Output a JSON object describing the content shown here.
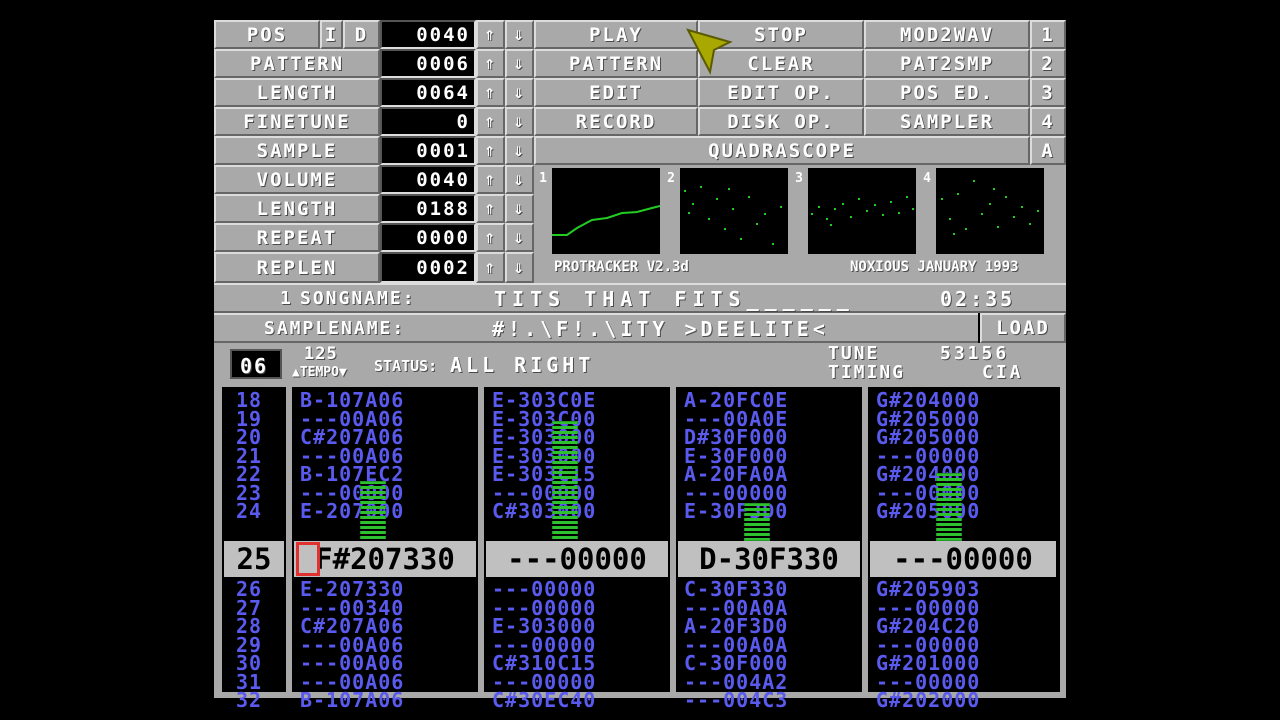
{
  "colors": {
    "panel": "#a9a9a9",
    "track_text": "#5a5aef",
    "scope_wave": "#22cc22",
    "vu_green": "#2fc02f",
    "vu_yellow": "#e0d040",
    "vu_red": "#d03030",
    "cursor": "#a8a800",
    "edit_cursor": "#e03030"
  },
  "left": {
    "pos_label": "POS",
    "i_label": "I",
    "d_label": "D",
    "pos_value": "0040",
    "pattern_label": "PATTERN",
    "pattern_value": "0006",
    "length_label": "LENGTH",
    "length_value": "0064",
    "finetune_label": "FINETUNE",
    "finetune_value": "0",
    "sample_label": "SAMPLE",
    "sample_value": "0001",
    "volume_label": "VOLUME",
    "volume_value": "0040",
    "slength_label": "LENGTH",
    "slength_value": "0188",
    "repeat_label": "REPEAT",
    "repeat_value": "0000",
    "replen_label": "REPLEN",
    "replen_value": "0002",
    "up_arrow": "⇑",
    "down_arrow": "⇓"
  },
  "buttons": {
    "play": "PLAY",
    "stop": "STOP",
    "mod2wav": "MOD2WAV",
    "one": "1",
    "pattern": "PATTERN",
    "clear": "CLEAR",
    "pat2smp": "PAT2SMP",
    "two": "2",
    "edit": "EDIT",
    "edit_op": "EDIT OP.",
    "pos_ed": "POS ED.",
    "three": "3",
    "record": "RECORD",
    "disk_op": "DISK OP.",
    "sampler": "SAMPLER",
    "four": "4",
    "quadrascope": "QUADRASCOPE",
    "a": "A",
    "load": "LOAD"
  },
  "scopes": {
    "labels": [
      "1",
      "2",
      "3",
      "4"
    ],
    "version": "PROTRACKER V2.3d",
    "credit": "NOXIOUS JANUARY 1993"
  },
  "song": {
    "songname_prefix": "1",
    "songname_label": "SONGNAME:",
    "songname_value": "TITS THAT FITS______",
    "time": "02:35",
    "samplename_label": "SAMPLENAME:",
    "samplename_value": "#!.\\F!.\\ITY >DEELITE<"
  },
  "status": {
    "speed": "06",
    "tempo_value": "125",
    "tempo_label": "▲TEMPO▼",
    "status_label": "STATUS:",
    "status_value": "ALL RIGHT",
    "tune_label": "TUNE",
    "tune_value": "53156",
    "timing_label": "TIMING",
    "timing_value": "CIA"
  },
  "pattern": {
    "rows_before": [
      "18",
      "19",
      "20",
      "21",
      "22",
      "23",
      "24"
    ],
    "current_row": "25",
    "rows_after": [
      "26",
      "27",
      "28",
      "29",
      "30",
      "31",
      "32"
    ],
    "tracks": [
      {
        "before": [
          "B-107A06",
          "---00A06",
          "C#207A06",
          "---00A06",
          "B-107EC2",
          "---00000",
          "E-207000"
        ],
        "current": "F#207330",
        "after": [
          "E-207330",
          "---00340",
          "C#207A06",
          "---00A06",
          "---00A06",
          "---00A06",
          "B-107A06"
        ],
        "vu_level": 0.4
      },
      {
        "before": [
          "E-303C0E",
          "E-303C00",
          "E-303000",
          "E-303000",
          "E-303C15",
          "---00000",
          "C#303000"
        ],
        "current": "---00000",
        "after": [
          "---00000",
          "---00000",
          "E-303000",
          "---00000",
          "C#310C15",
          "---00000",
          "C#30EC40"
        ],
        "vu_level": 0.8
      },
      {
        "before": [
          "A-20FC0E",
          "---00A0E",
          "D#30F000",
          "E-30F000",
          "A-20FA0A",
          "---00000",
          "E-30F3D0"
        ],
        "current": "D-30F330",
        "after": [
          "C-30F330",
          "---00A0A",
          "A-20F3D0",
          "---00A0A",
          "C-30F000",
          "---004A2",
          "---004C3"
        ],
        "vu_level": 0.25
      },
      {
        "before": [
          "G#204000",
          "G#205000",
          "G#205000",
          "---00000",
          "G#204000",
          "---00000",
          "G#205000"
        ],
        "current": "---00000",
        "after": [
          "G#205903",
          "---00000",
          "G#204C20",
          "---00000",
          "G#201000",
          "---00000",
          "G#202000"
        ],
        "vu_level": 0.45
      }
    ]
  }
}
